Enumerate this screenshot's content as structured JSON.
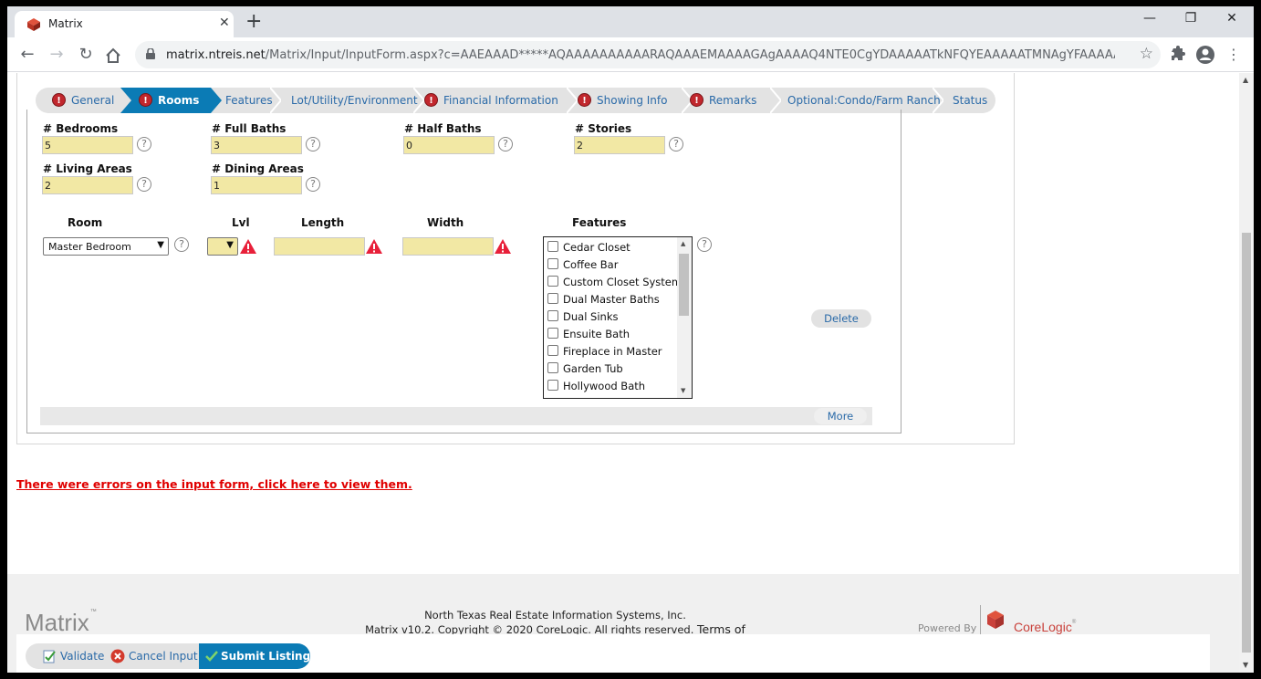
{
  "browser": {
    "tab_title": "Matrix",
    "new_tab": "+",
    "url_host": "matrix.ntreis.net",
    "url_path": "/Matrix/Input/InputForm.aspx?c=AAEAAAD*****AQAAAAAAAAAARAQAAAEMAAAAGAgAAAAQ4NTE0CgYDAAAAATkNFQYEAAAAATMNAgYFAAAAATcN..."
  },
  "steps": [
    {
      "label": "General",
      "error": true,
      "active": false
    },
    {
      "label": "Rooms",
      "error": true,
      "active": true
    },
    {
      "label": "Features",
      "error": false,
      "active": false
    },
    {
      "label": "Lot/Utility/Environment",
      "error": false,
      "active": false
    },
    {
      "label": "Financial Information",
      "error": true,
      "active": false
    },
    {
      "label": "Showing Info",
      "error": true,
      "active": false
    },
    {
      "label": "Remarks",
      "error": true,
      "active": false
    },
    {
      "label": "Optional:Condo/Farm Ranch",
      "error": false,
      "active": false
    },
    {
      "label": "Status",
      "error": false,
      "active": false
    }
  ],
  "fields": {
    "bedrooms": {
      "label": "# Bedrooms",
      "value": "5"
    },
    "full_baths": {
      "label": "# Full Baths",
      "value": "3"
    },
    "half_baths": {
      "label": "# Half Baths",
      "value": "0"
    },
    "stories": {
      "label": "# Stories",
      "value": "2"
    },
    "living_areas": {
      "label": "# Living Areas",
      "value": "2"
    },
    "dining_areas": {
      "label": "# Dining Areas",
      "value": "1"
    }
  },
  "room_table": {
    "headers": {
      "room": "Room",
      "lvl": "Lvl",
      "length": "Length",
      "width": "Width",
      "features": "Features"
    },
    "room_value": "Master Bedroom",
    "lvl_value": "",
    "length_value": "",
    "width_value": "",
    "feature_options": [
      "Cedar Closet",
      "Coffee Bar",
      "Custom Closet System",
      "Dual Master Baths",
      "Dual Sinks",
      "Ensuite Bath",
      "Fireplace in Master",
      "Garden Tub",
      "Hollywood Bath"
    ],
    "delete_label": "Delete",
    "more_label": "More"
  },
  "error_link": "There were errors on the input form, click here to view them.",
  "footer": {
    "logo": "Matrix",
    "logo_tm": "™",
    "org": "North Texas Real Estate Information Systems, Inc.",
    "copyright": "Matrix v10.2. Copyright © 2020 CoreLogic. All rights reserved.",
    "terms": "Terms of Use.",
    "powered_by": "Powered By",
    "corelogic": "CoreLogic",
    "corelogic_tm": "®"
  },
  "actions": {
    "validate": "Validate",
    "cancel": "Cancel Input",
    "submit": "Submit Listing"
  },
  "colors": {
    "accent": "#0b7bb5",
    "field_bg": "#f2e8a4",
    "error": "#c1272d",
    "link": "#2a6aa8"
  }
}
